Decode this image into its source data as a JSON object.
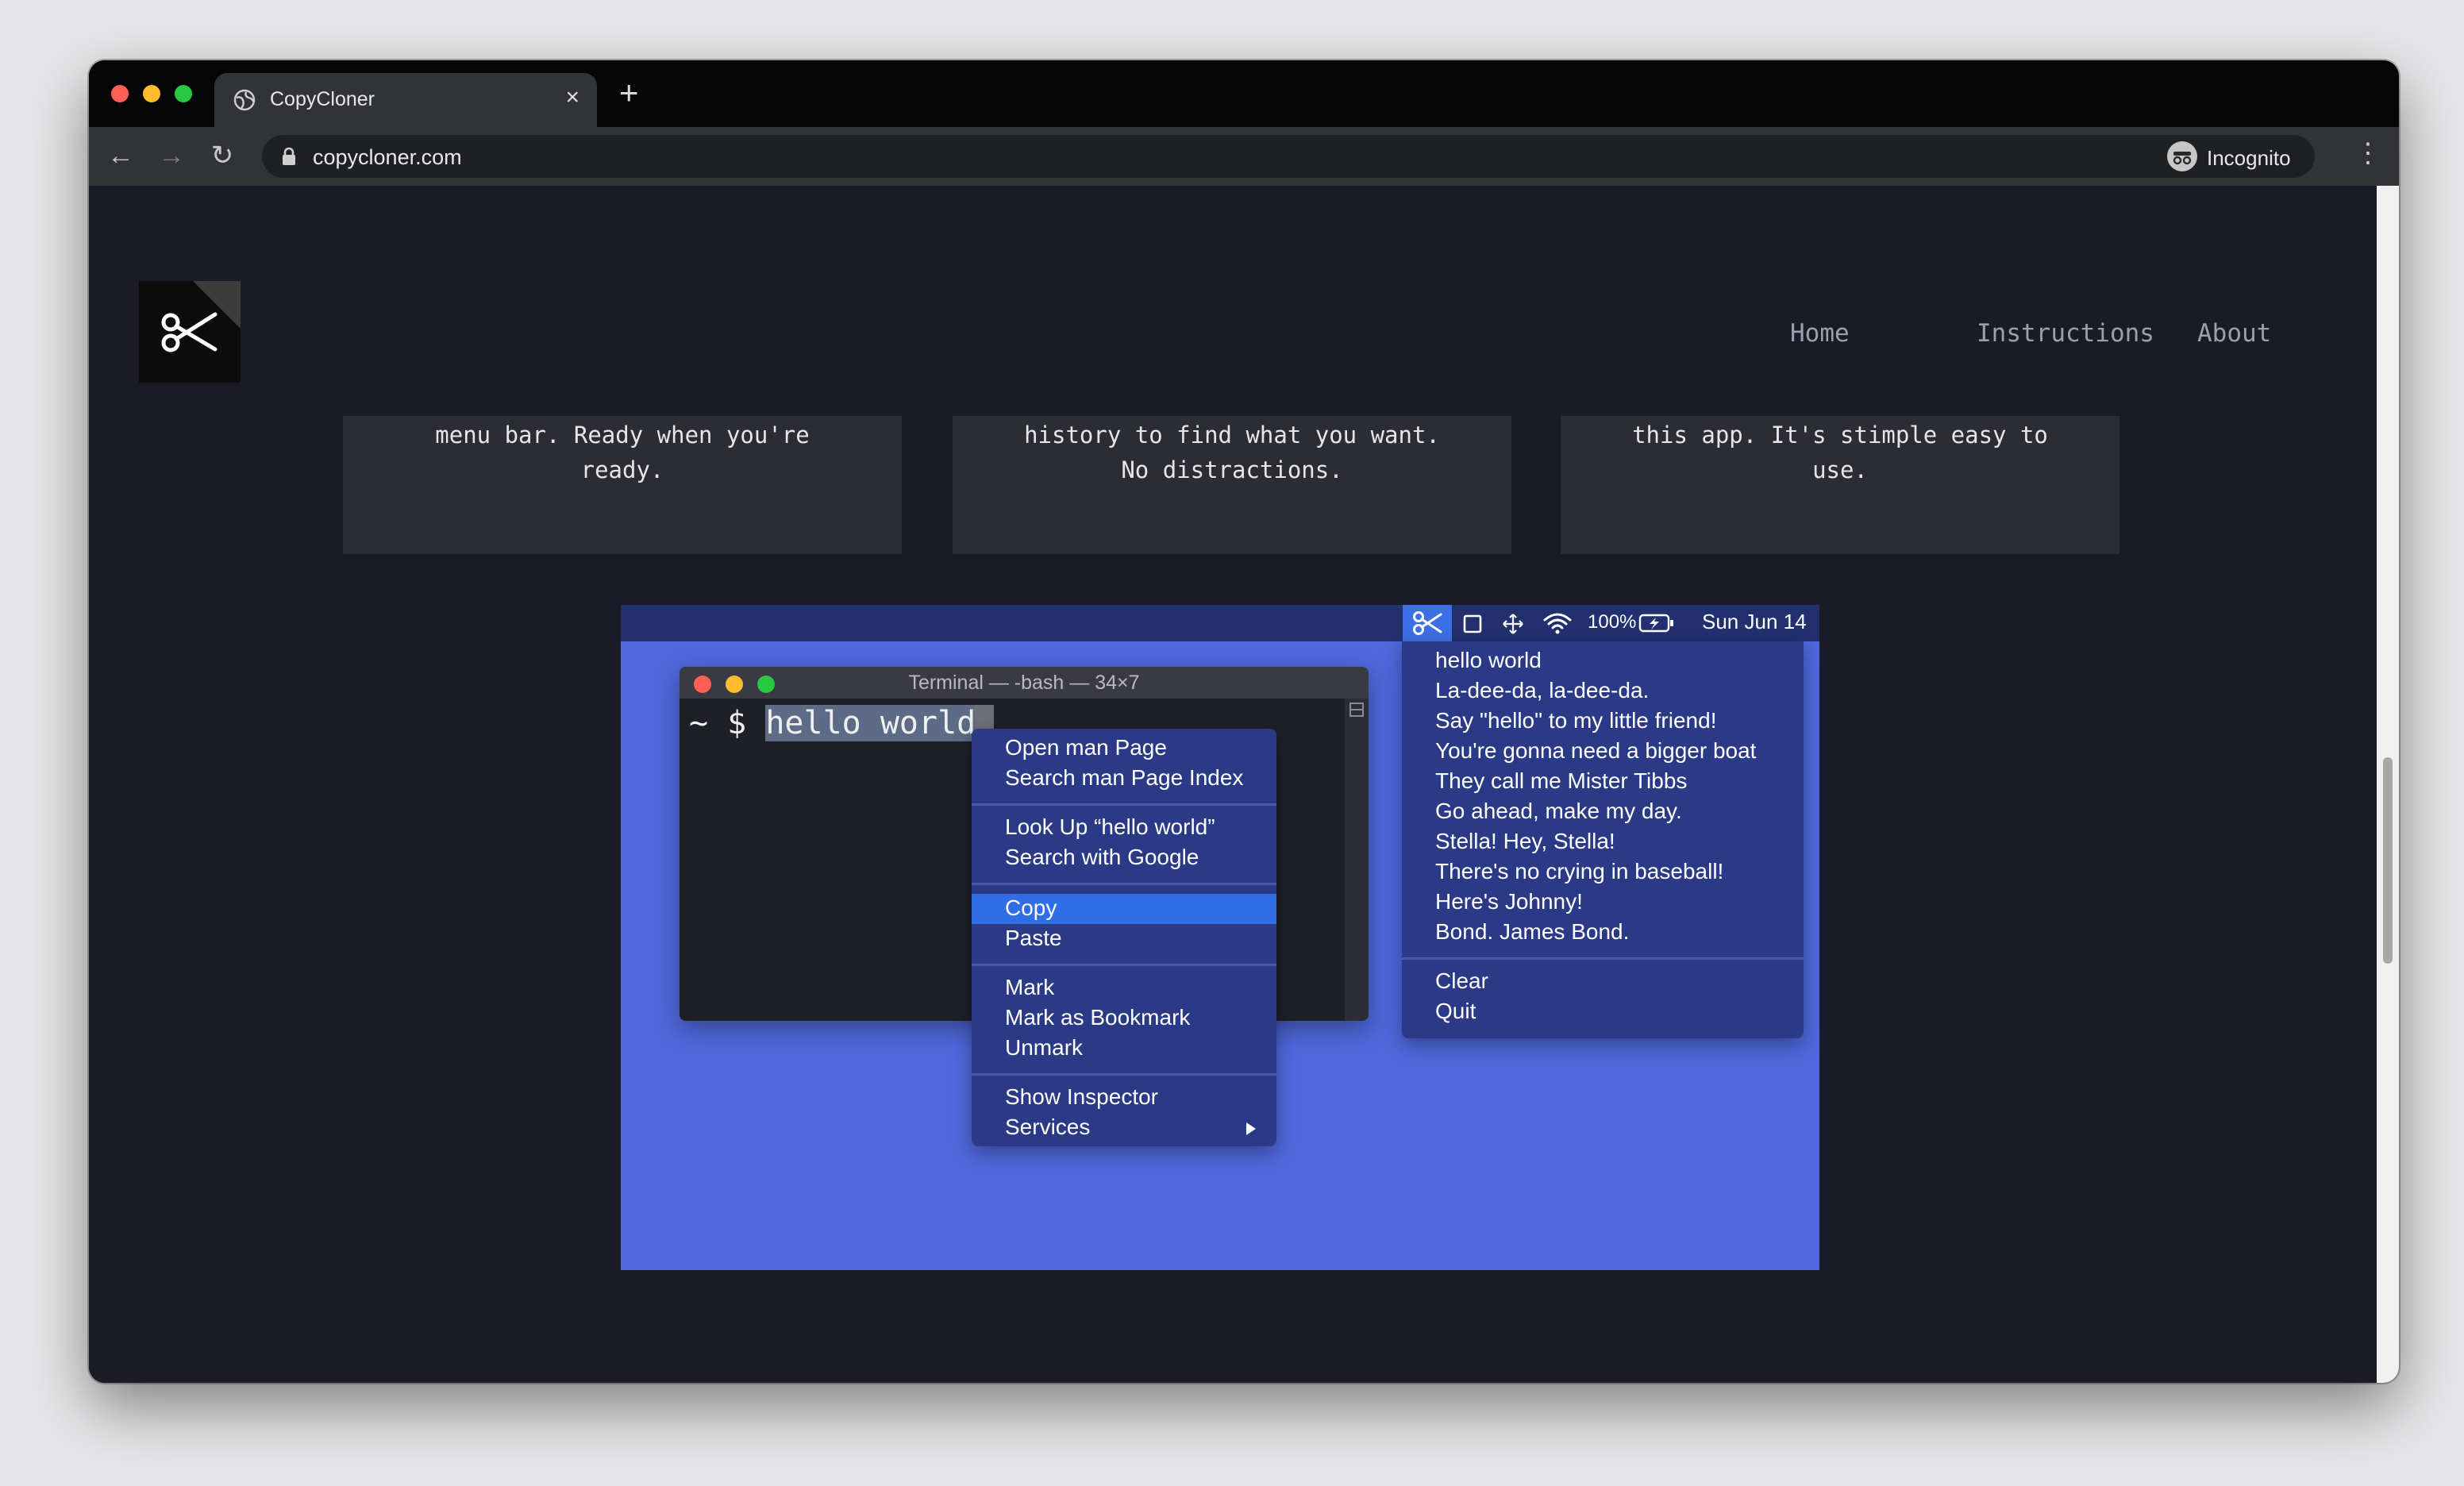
{
  "browser": {
    "tab_title": "CopyCloner",
    "new_tab": "+",
    "close": "×",
    "url": "copycloner.com",
    "profile": "Incognito",
    "back": "←",
    "forward": "→",
    "reload": "↻",
    "star": "☆",
    "menu": "⋮"
  },
  "site": {
    "nav": [
      "Home",
      "Instructions",
      "About"
    ],
    "cards": [
      {
        "line1": "menu bar. Ready when you're",
        "line2": "ready."
      },
      {
        "line1": "history to find what you want.",
        "line2": "No distractions."
      },
      {
        "line1": "this app. It's stimple easy to",
        "line2": "use."
      }
    ]
  },
  "demo": {
    "menubar": {
      "battery": "100%",
      "date": "Sun Jun 14"
    },
    "terminal": {
      "title": "Terminal — -bash — 34×7",
      "prompt": "~ $ ",
      "selected_text": "hello world"
    },
    "context_menu": [
      "Open man Page",
      "Search man Page Index",
      "Look Up “hello world”",
      "Search with Google",
      "Copy",
      "Paste",
      "Mark",
      "Mark as Bookmark",
      "Unmark",
      "Show Inspector",
      "Services"
    ],
    "clipboard_history": [
      "hello world",
      "La-dee-da, la-dee-da.",
      "Say \"hello\" to my little friend!",
      "You're gonna need a bigger boat",
      "They call me Mister Tibbs",
      "Go ahead, make my day.",
      "Stella! Hey, Stella!",
      "There's no crying in baseball!",
      "Here's Johnny!",
      "Bond. James Bond."
    ],
    "clipboard_actions": [
      "Clear",
      "Quit"
    ]
  }
}
